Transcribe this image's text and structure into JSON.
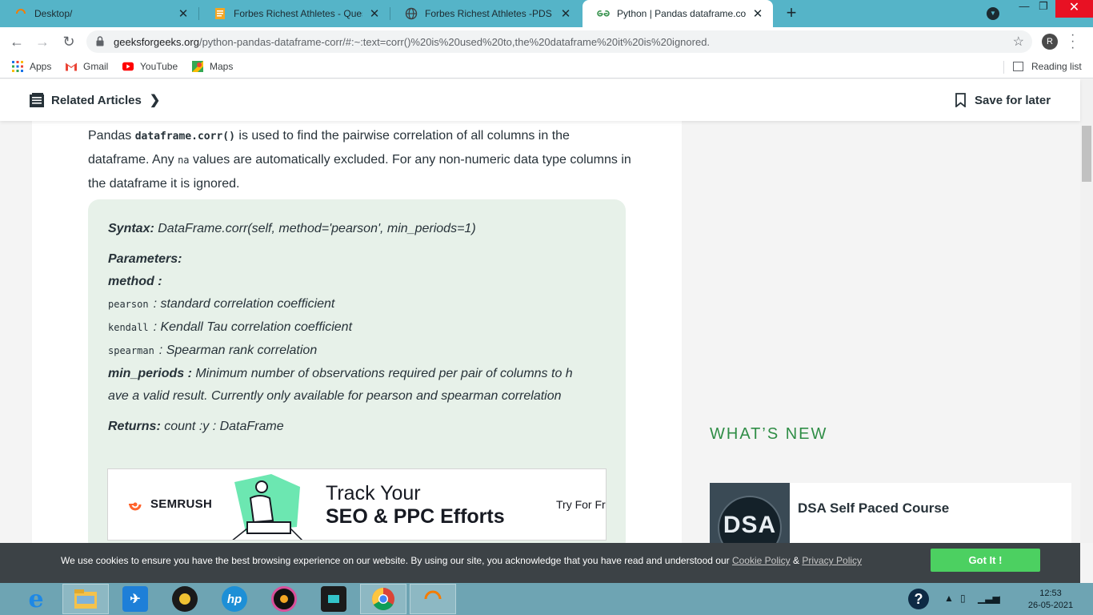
{
  "tabs": [
    {
      "title": "Desktop/",
      "close": "✕"
    },
    {
      "title": "Forbes Richest Athletes - Questio",
      "close": "✕"
    },
    {
      "title": "Forbes Richest Athletes -PDS Solu",
      "close": "✕"
    },
    {
      "title": "Python | Pandas dataframe.corr()",
      "close": "✕"
    }
  ],
  "address": {
    "domain": "geeksforgeeks.org",
    "path": "/python-pandas-dataframe-corr/#:~:text=corr()%20is%20used%20to,the%20dataframe%20it%20is%20ignored.",
    "avatar_initial": "R"
  },
  "bookmarks": [
    {
      "label": "Apps",
      "icon": "apps-grid-icon"
    },
    {
      "label": "Gmail",
      "icon": "gmail-icon"
    },
    {
      "label": "YouTube",
      "icon": "youtube-icon"
    },
    {
      "label": "Maps",
      "icon": "maps-icon"
    }
  ],
  "reading_list": "Reading list",
  "subheader": {
    "related": "Related Articles",
    "save_later": "Save for later"
  },
  "intro": {
    "p1": "Pandas ",
    "code": "dataframe.corr()",
    "p2": " is used to find the pairwise correlation of all columns in the dataframe. Any ",
    "na": "na",
    "p3": " values are automatically excluded. For any non-numeric data type columns in the dataframe it is ignored."
  },
  "syntax": {
    "syntax_label": "Syntax:",
    "syntax_value": " DataFrame.corr(self, method='pearson', min_periods=1)",
    "parameters_label": "Parameters:",
    "method_label": "method :",
    "methods": [
      {
        "name": "pearson",
        "desc": ": standard correlation coefficient"
      },
      {
        "name": "kendall",
        "desc": ": Kendall Tau correlation coefficient"
      },
      {
        "name": "spearman",
        "desc": ": Spearman rank correlation"
      }
    ],
    "min_periods_label": "min_periods :",
    "min_periods_line1": " Minimum number of observations required per pair of columns to h",
    "min_periods_line2": "ave a valid result. Currently only available for pearson and spearman correlation",
    "returns_label": "Returns:",
    "returns_value": " count :y : DataFrame"
  },
  "ad": {
    "brand": "SEMRUSH",
    "line1": "Track Your",
    "line2": "SEO & PPC Efforts",
    "cta": "Try For Fr"
  },
  "sidebar": {
    "whats_new": "WHAT’S NEW",
    "card_thumb": "DSA",
    "card_title": "DSA Self Paced Course"
  },
  "cookie": {
    "text": "We use cookies to ensure you have the best browsing experience on our website. By using our site, you acknowledge that you have read and understood our ",
    "policy1": "Cookie Policy",
    "amp": " & ",
    "policy2": "Privacy Policy",
    "button": "Got It !"
  },
  "clock": {
    "time": "12:53",
    "date": "26-05-2021"
  },
  "colors": {
    "accent_green": "#2f8d46",
    "tab_strip": "#55b4c8",
    "cookie_button": "#4cd061"
  }
}
